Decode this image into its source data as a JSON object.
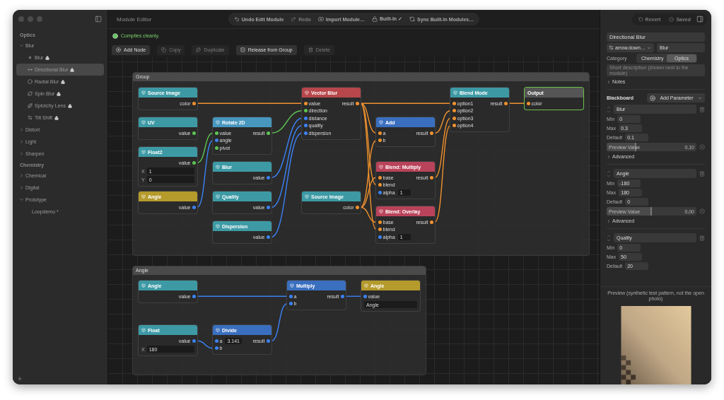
{
  "window": {
    "title": "Module Editor"
  },
  "sidebar": {
    "sections": [
      {
        "title": "Optics",
        "items": [
          {
            "label": "Blur",
            "expanded": true,
            "children": [
              {
                "label": "Blur",
                "locked": true,
                "selected": false
              },
              {
                "label": "Directional Blur",
                "locked": true,
                "selected": true
              },
              {
                "label": "Radial Blur",
                "locked": true,
                "selected": false
              },
              {
                "label": "Spin Blur",
                "locked": true,
                "selected": false
              },
              {
                "label": "Splotchy Lens",
                "locked": true,
                "selected": false
              },
              {
                "label": "Tilt Shift",
                "locked": true,
                "selected": false
              }
            ]
          },
          {
            "label": "Distort",
            "expanded": false
          },
          {
            "label": "Light",
            "expanded": false
          },
          {
            "label": "Sharpen",
            "expanded": false
          }
        ]
      },
      {
        "title": "Chemistry",
        "items": [
          {
            "label": "Chemical",
            "expanded": false
          },
          {
            "label": "Digital",
            "expanded": false
          },
          {
            "label": "Prototype",
            "expanded": true,
            "children": [
              {
                "label": "Loopdemo *",
                "locked": false,
                "selected": false
              }
            ]
          }
        ]
      }
    ]
  },
  "toolbar": [
    {
      "label": "Undo Edit Module",
      "disabled": false
    },
    {
      "label": "Redo",
      "disabled": true
    },
    {
      "label": "Import Module…",
      "disabled": false
    },
    {
      "label": "Built-In ✓",
      "disabled": false
    },
    {
      "label": "Sync Built-In Modules…",
      "disabled": false
    }
  ],
  "status": {
    "message": "Compiles cleanly.",
    "ok": true
  },
  "actions": [
    {
      "label": "Add Node",
      "disabled": false
    },
    {
      "label": "Copy",
      "disabled": true
    },
    {
      "label": "Duplicate",
      "disabled": true
    },
    {
      "label": "Release from Group",
      "disabled": false
    },
    {
      "label": "Delete",
      "disabled": true
    }
  ],
  "groups": [
    {
      "title": "Group",
      "nodes": [
        {
          "title": "Source Image",
          "kind": "node",
          "color": "#3d9aa5",
          "rows": [
            {
              "output": "color",
              "kind": "color"
            }
          ]
        },
        {
          "title": "UV",
          "kind": "node",
          "color": "#3d9aa5",
          "rows": [
            {
              "output": "value",
              "kind": "vector"
            }
          ]
        },
        {
          "title": "Float2",
          "kind": "node",
          "color": "#3d9aa5",
          "rows": [
            {
              "output": "value",
              "kind": "vector"
            }
          ],
          "fields": [
            {
              "label": "X",
              "value": "1"
            },
            {
              "label": "Y",
              "value": "0"
            }
          ]
        },
        {
          "title": "Angle",
          "kind": "node",
          "color": "#b59a2c",
          "rows": [
            {
              "output": "value",
              "kind": "float"
            }
          ]
        },
        {
          "title": "Rotate 2D",
          "kind": "node",
          "color": "#4797bf",
          "rows": [
            {
              "input": "value",
              "output": "result",
              "kind": "vector"
            },
            {
              "input": "angle",
              "kind": "float"
            },
            {
              "input": "pivot",
              "kind": "vector"
            }
          ]
        },
        {
          "title": "Blur",
          "kind": "node",
          "color": "#3d9aa5",
          "rows": [
            {
              "output": "value",
              "kind": "float"
            }
          ]
        },
        {
          "title": "Quality",
          "kind": "node",
          "color": "#3d9aa5",
          "rows": [
            {
              "output": "value",
              "kind": "float"
            }
          ]
        },
        {
          "title": "Dispersion",
          "kind": "node",
          "color": "#3d9aa5",
          "rows": [
            {
              "output": "value",
              "kind": "float"
            }
          ]
        },
        {
          "title": "Vector Blur",
          "kind": "node",
          "color": "#b7474b",
          "rows": [
            {
              "input": "value",
              "output": "result",
              "kind": "color"
            },
            {
              "input": "direction",
              "kind": "vector"
            },
            {
              "input": "distance",
              "kind": "float"
            },
            {
              "input": "quality",
              "kind": "float"
            },
            {
              "input": "dispersion",
              "kind": "float"
            }
          ]
        },
        {
          "title": "Source Image",
          "kind": "node",
          "color": "#3d9aa5",
          "rows": [
            {
              "output": "color",
              "kind": "color"
            }
          ]
        },
        {
          "title": "Add",
          "kind": "node",
          "color": "#3a6fbf",
          "rows": [
            {
              "input": "a",
              "output": "result",
              "kind": "color"
            },
            {
              "input": "b",
              "kind": "color"
            }
          ]
        },
        {
          "title": "Blend: Multiply",
          "kind": "node",
          "color": "#b9435a",
          "rows": [
            {
              "input": "base",
              "output": "result",
              "kind": "color"
            },
            {
              "input": "blend",
              "kind": "color"
            },
            {
              "input": "alpha",
              "kind": "float",
              "value": "1"
            }
          ]
        },
        {
          "title": "Blend: Overlay",
          "kind": "node",
          "color": "#b9435a",
          "rows": [
            {
              "input": "base",
              "output": "result",
              "kind": "color"
            },
            {
              "input": "blend",
              "kind": "color"
            },
            {
              "input": "alpha",
              "kind": "float",
              "value": "1"
            }
          ]
        },
        {
          "title": "Blend Mode",
          "kind": "node",
          "color": "#3d9aa5",
          "rows": [
            {
              "input": "option1",
              "output": "result",
              "kind": "color"
            },
            {
              "input": "option2",
              "kind": "color"
            },
            {
              "input": "option3",
              "kind": "color"
            },
            {
              "input": "option4",
              "kind": "color"
            }
          ]
        },
        {
          "title": "Output",
          "kind": "output",
          "color": "#555555",
          "rows": [
            {
              "input": "color",
              "kind": "color"
            }
          ]
        }
      ]
    },
    {
      "title": "Angle",
      "nodes": [
        {
          "title": "Angle",
          "kind": "node",
          "color": "#3d9aa5",
          "rows": [
            {
              "output": "value",
              "kind": "float"
            }
          ]
        },
        {
          "title": "Float",
          "kind": "node",
          "color": "#3d9aa5",
          "rows": [
            {
              "output": "value",
              "kind": "float"
            }
          ],
          "fields": [
            {
              "label": "X",
              "value": "180"
            }
          ]
        },
        {
          "title": "Divide",
          "kind": "node",
          "color": "#3a6fbf",
          "rows": [
            {
              "input": "a",
              "output": "result",
              "kind": "float",
              "value": "3.141"
            },
            {
              "input": "b",
              "kind": "float"
            }
          ]
        },
        {
          "title": "Multiply",
          "kind": "node",
          "color": "#3a6fbf",
          "rows": [
            {
              "input": "a",
              "output": "result",
              "kind": "float"
            },
            {
              "input": "b",
              "kind": "float"
            }
          ]
        },
        {
          "title": "Angle",
          "kind": "node",
          "color": "#b59a2c",
          "rows": [
            {
              "input": "value",
              "kind": "float"
            }
          ],
          "fields": [
            {
              "value": "Angle"
            }
          ]
        }
      ]
    }
  ],
  "inspector": {
    "revert": {
      "label": "Revert",
      "disabled": true
    },
    "saved": {
      "label": "Saved",
      "disabled": true
    },
    "name": "Directional Blur",
    "symbol": "arrow.down…",
    "base": "Blur",
    "category_label": "Category",
    "categories": [
      {
        "label": "Chemistry",
        "selected": false
      },
      {
        "label": "Optics",
        "selected": true
      }
    ],
    "description_placeholder": "Short description (shown next to the module)",
    "notes": {
      "label": "Notes",
      "expanded": false
    }
  },
  "blackboard": {
    "title": "Blackboard",
    "add_button": "Add Parameter",
    "parameters": [
      {
        "name": "Blur",
        "fields": [
          {
            "label": "Min",
            "value": "0"
          },
          {
            "label": "Max",
            "value": "0.3"
          },
          {
            "label": "Default",
            "value": "0.1"
          }
        ],
        "preview": {
          "label": "Preview Value",
          "level": 0.33,
          "reading": "0,10"
        },
        "advanced": {
          "label": "Advanced",
          "expanded": false
        }
      },
      {
        "name": "Angle",
        "fields": [
          {
            "label": "Min",
            "value": "-180"
          },
          {
            "label": "Max",
            "value": "180"
          },
          {
            "label": "Default",
            "value": "0"
          }
        ],
        "preview": {
          "label": "Preview Value",
          "level": 0.5,
          "reading": "0,00"
        },
        "advanced": {
          "label": "Advanced",
          "expanded": false
        }
      },
      {
        "name": "Quality",
        "fields": [
          {
            "label": "Min",
            "value": "0"
          },
          {
            "label": "Max",
            "value": "50"
          },
          {
            "label": "Default",
            "value": "20"
          }
        ]
      }
    ]
  },
  "preview": {
    "caption": "Preview (synthetic test pattern, not the open photo)"
  }
}
